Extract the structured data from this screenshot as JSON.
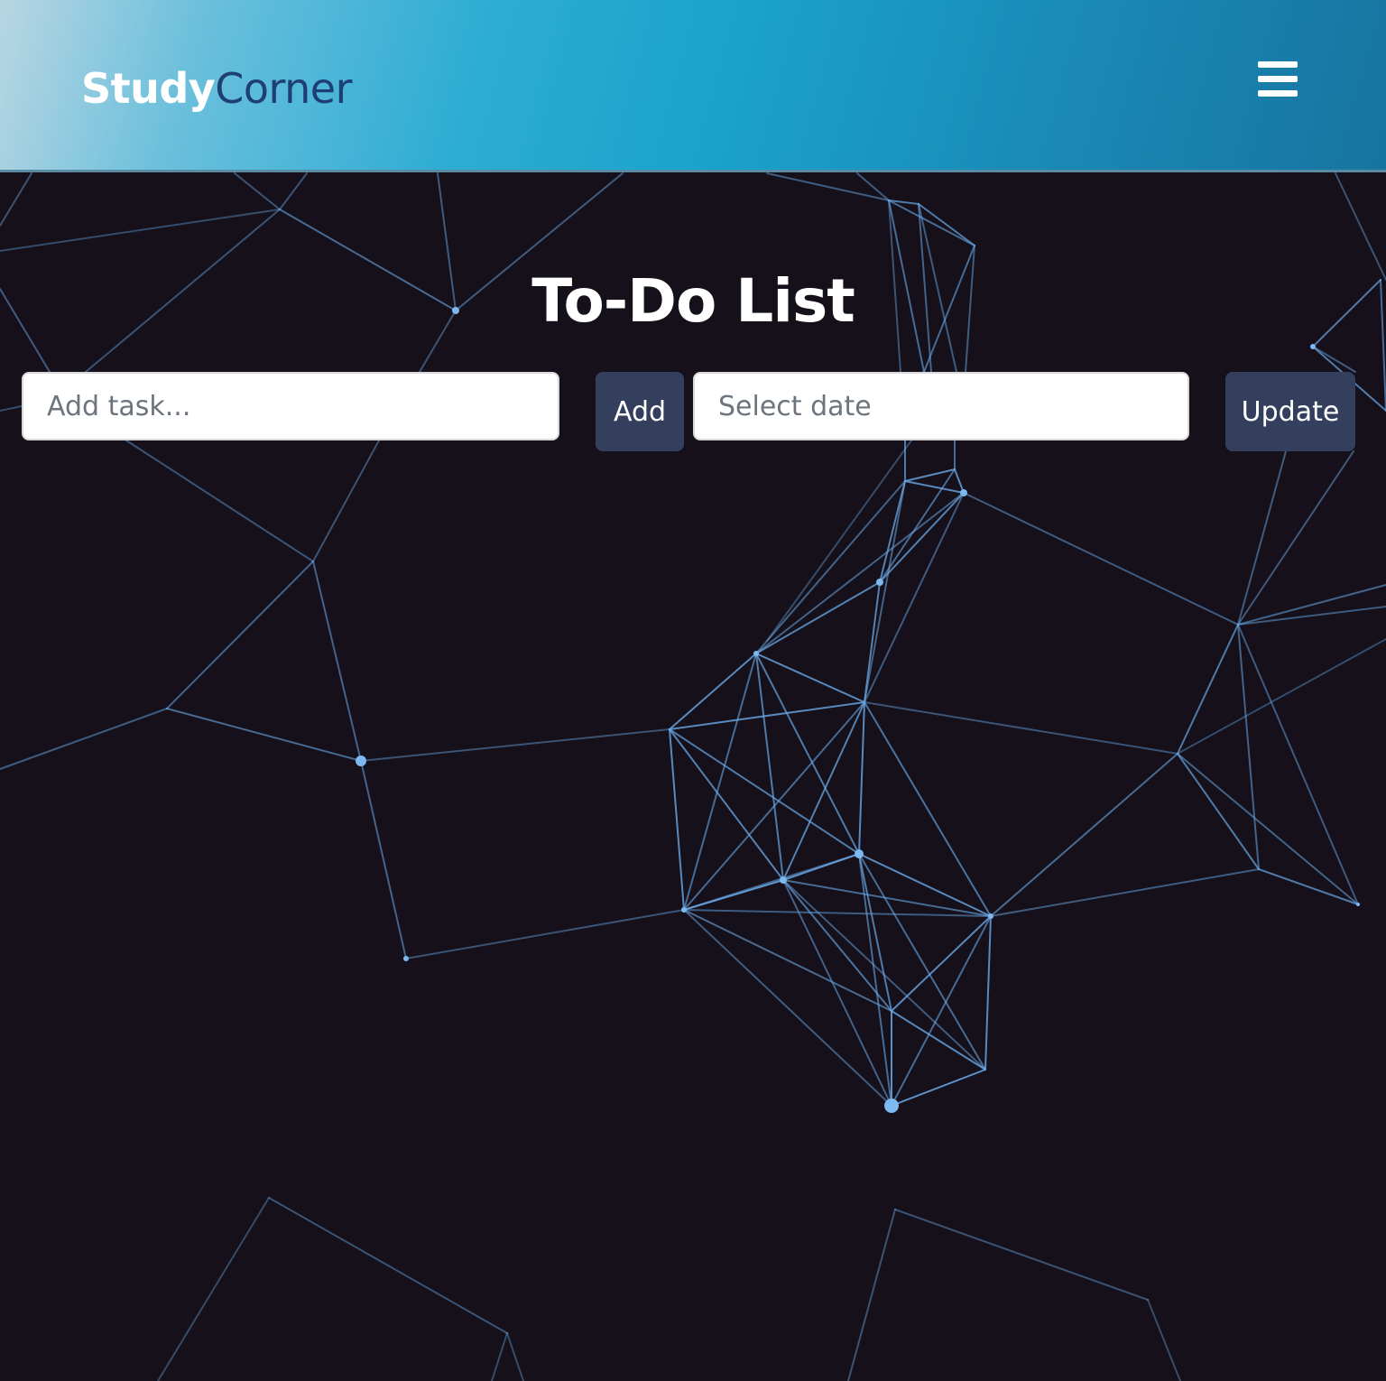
{
  "header": {
    "logo_part1": "Study",
    "logo_part2": "Corner",
    "menu_icon": "hamburger-menu-icon"
  },
  "main": {
    "title": "To-Do List",
    "task_input": {
      "placeholder": "Add task...",
      "value": ""
    },
    "add_button": "Add",
    "date_input": {
      "placeholder": "Select date",
      "value": ""
    },
    "update_button": "Update"
  },
  "colors": {
    "background": "#15101a",
    "button": "#343f5e",
    "network_line": "#6aa8e6"
  }
}
